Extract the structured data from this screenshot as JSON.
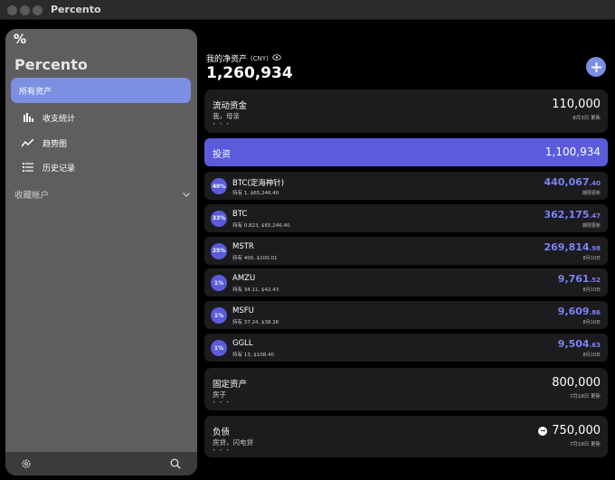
{
  "window": {
    "title": "Percento"
  },
  "sidebar": {
    "logo": "%",
    "app_name": "Percento",
    "items": [
      {
        "label": "所有资产",
        "icon": ""
      },
      {
        "label": "收支统计",
        "icon": "bar-chart-icon"
      },
      {
        "label": "趋势图",
        "icon": "trend-line-icon"
      },
      {
        "label": "历史记录",
        "icon": "list-icon"
      }
    ],
    "section": "收藏帐户",
    "bottom_icons": [
      "gear-icon",
      "search-icon"
    ]
  },
  "header": {
    "label": "我的净资产",
    "currency": "(CNY)",
    "net_worth": "1,260,934"
  },
  "liquid": {
    "title": "流动资金",
    "sub": "我，母亲",
    "dots": "• • •",
    "amount": "110,000",
    "date": "8月3日 更新"
  },
  "investment": {
    "title": "投资",
    "amount": "1,100,934",
    "holdings": [
      {
        "pct": "40%",
        "name": "BTC(定海神针)",
        "detail": "持有 1, $65,246.40",
        "int": "440,067",
        "dec": ".40",
        "date": "期限更新"
      },
      {
        "pct": "33%",
        "name": "BTC",
        "detail": "持有 0.823, $65,246.40",
        "int": "362,175",
        "dec": ".47",
        "date": "期限更新"
      },
      {
        "pct": "25%",
        "name": "MSTR",
        "detail": "持有 400, $100.01",
        "int": "269,814",
        "dec": ".98",
        "date": "8月10日"
      },
      {
        "pct": "1%",
        "name": "AMZU",
        "detail": "持有 34.11, $42.43",
        "int": "9,761",
        "dec": ".52",
        "date": "8月10日"
      },
      {
        "pct": "1%",
        "name": "MSFU",
        "detail": "持有 37.24, $38.26",
        "int": "9,609",
        "dec": ".86",
        "date": "8月10日"
      },
      {
        "pct": "1%",
        "name": "GGLL",
        "detail": "持有 13, $108.40",
        "int": "9,504",
        "dec": ".63",
        "date": "8月10日"
      }
    ]
  },
  "fixed": {
    "title": "固定资产",
    "sub": "房子",
    "dots": "• • •",
    "amount": "800,000",
    "date": "7月18日 更新"
  },
  "liability": {
    "title": "负债",
    "sub": "房贷，闪电贷",
    "dots": "• • •",
    "amount": "750,000",
    "date": "7月18日 更新"
  },
  "colors": {
    "accent": "#5b5bdc",
    "sidebar_active": "#7c90e3",
    "value_blue": "#7b82f5"
  }
}
